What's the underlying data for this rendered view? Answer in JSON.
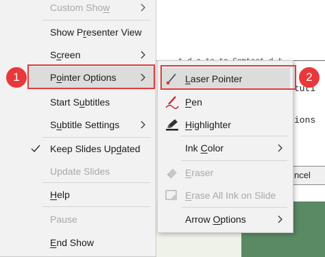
{
  "background": {
    "line1": "t d a to ta Comtact d t",
    "line2": "tuti",
    "line3": "ions",
    "cancel_fragment": "ncel"
  },
  "main_menu": {
    "items": [
      {
        "label": "Custom Show",
        "accel": "w",
        "disabled": true,
        "submenu": true
      },
      {
        "label": "Show Presenter View",
        "accel": "r",
        "disabled": false,
        "submenu": false
      },
      {
        "label": "Screen",
        "accel": "c",
        "disabled": false,
        "submenu": true
      },
      {
        "label": "Pointer Options",
        "accel": "o",
        "disabled": false,
        "submenu": true,
        "highlighted": true
      },
      {
        "label": "Start Subtitles",
        "accel": "u",
        "disabled": false,
        "submenu": false
      },
      {
        "label": "Subtitle Settings",
        "accel": "u",
        "disabled": false,
        "submenu": true
      },
      {
        "label": "Keep Slides Updated",
        "accel": "d",
        "disabled": false,
        "submenu": false,
        "checked": true
      },
      {
        "label": "Update Slides",
        "accel": "",
        "disabled": true,
        "submenu": false
      },
      {
        "label": "Help",
        "accel": "H",
        "disabled": false,
        "submenu": false
      },
      {
        "label": "Pause",
        "accel": "",
        "disabled": true,
        "submenu": false
      },
      {
        "label": "End Show",
        "accel": "E",
        "disabled": false,
        "submenu": false
      }
    ]
  },
  "pointer_submenu": {
    "items": [
      {
        "label": "Laser Pointer",
        "icon": "laser-pointer-icon",
        "disabled": false,
        "highlighted": true
      },
      {
        "label": "Pen",
        "icon": "pen-icon",
        "disabled": false
      },
      {
        "label": "Highlighter",
        "icon": "highlighter-icon",
        "disabled": false
      },
      {
        "label": "Ink Color",
        "icon": "",
        "disabled": false,
        "submenu": true
      },
      {
        "label": "Eraser",
        "icon": "eraser-icon",
        "disabled": true
      },
      {
        "label": "Erase All Ink on Slide",
        "icon": "erase-all-icon",
        "disabled": true
      },
      {
        "label": "Arrow Options",
        "icon": "",
        "disabled": false,
        "submenu": true
      }
    ]
  },
  "callouts": {
    "step1": "1",
    "step2": "2"
  },
  "colors": {
    "callout_red": "#e8383c",
    "menu_bg": "#f2f2f2",
    "highlight": "#dcdcdc"
  }
}
